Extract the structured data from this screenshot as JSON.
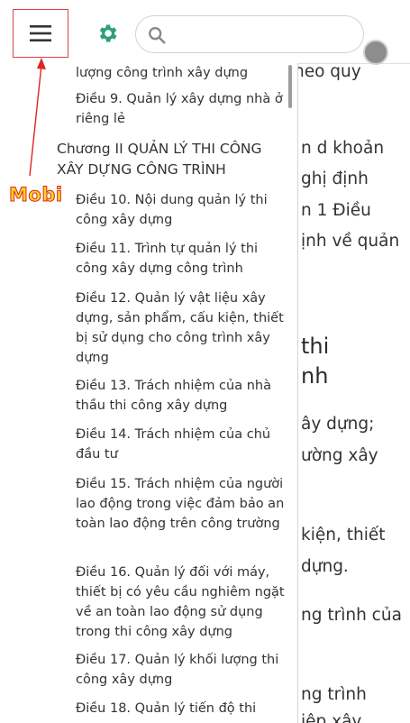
{
  "header": {
    "search_placeholder": ""
  },
  "icons": {
    "menu": "hamburger-icon",
    "settings": "gear-icon",
    "search": "search-icon",
    "avatar": "avatar"
  },
  "colors": {
    "menu_border": "#d9434b",
    "gear": "#2f9e7a",
    "annotation_text": "#ffd21f",
    "annotation_stroke": "#d62828"
  },
  "background_fragments": [
    "heo quy",
    "n d khoản",
    "ghị định",
    "n 1 Điều",
    "ịnh về quản",
    "thi",
    "nh",
    "ây dựng;",
    "ường xây",
    "kiện, thiết",
    "dựng.",
    "ng trình của",
    "ng trình",
    "iệp xây"
  ],
  "toc": [
    "lượng công trình xây dựng",
    "Điều 9. Quản lý xây dựng nhà ở riêng lẻ",
    "Chương II QUẢN LÝ THI CÔNG XÂY DỰNG CÔNG TRÌNH",
    "Điều 10. Nội dung quản lý thi công xây dựng",
    "Điều 11. Trình tự quản lý thi công xây dựng công trình",
    "Điều 12. Quản lý vật liệu xây dựng, sản phẩm, cấu kiện, thiết bị sử dụng cho công trình xây dựng",
    "Điều 13. Trách nhiệm của nhà thầu thi công xây dựng",
    "Điều 14. Trách nhiệm của chủ đầu tư",
    "Điều 15. Trách nhiệm của người lao động trong việc đảm bảo an toàn lao động trên công trường",
    "Điều 16. Quản lý đối với máy, thiết bị có yêu cầu nghiêm ngặt về an toàn lao động sử dụng trong thi công xây dựng",
    "Điều 17. Quản lý khối lượng thi công xây dựng",
    "Điều 18. Quản lý tiến độ thi"
  ],
  "annotation": {
    "label": "Mobi"
  }
}
